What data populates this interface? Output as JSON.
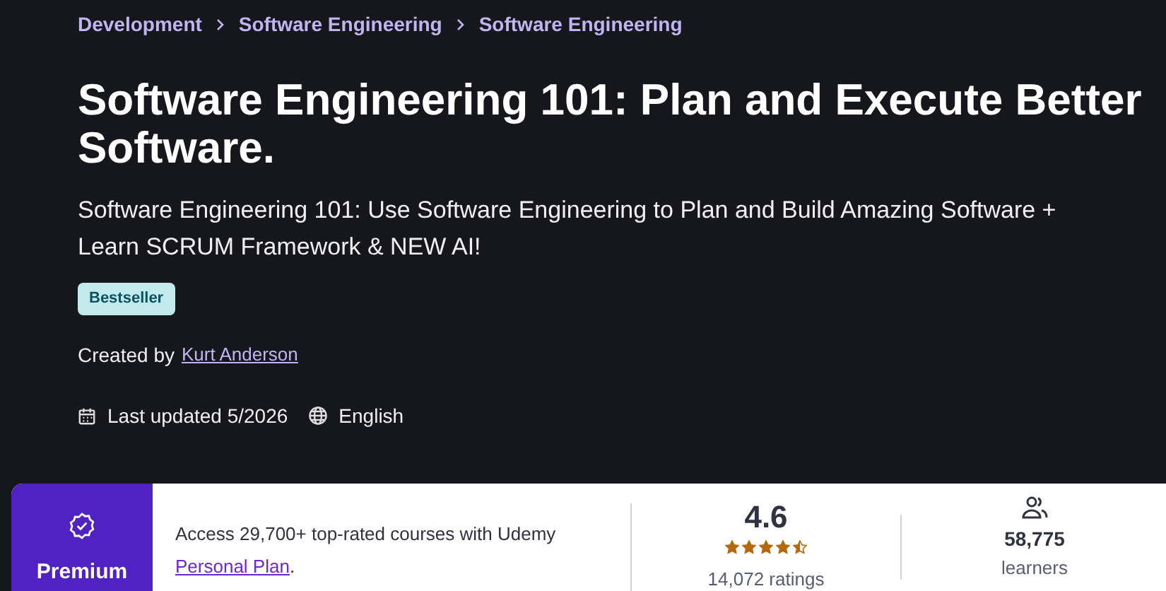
{
  "breadcrumbs": [
    "Development",
    "Software Engineering",
    "Software Engineering"
  ],
  "title": "Software Engineering 101: Plan and Execute Better Software.",
  "subtitle": "Software Engineering 101: Use Software Engineering to Plan and Build Amazing Software + Learn SCRUM Framework & NEW AI!",
  "badge": "Bestseller",
  "created_by": {
    "label": "Created by",
    "author": "Kurt Anderson"
  },
  "last_updated": "Last updated 5/2026",
  "language": "English",
  "premium_card": {
    "label": "Premium",
    "text": "Access 29,700+ top-rated courses with Udemy",
    "link": "Personal Plan",
    "link_suffix": ".",
    "rating": {
      "value": "4.6",
      "stars": 4.5,
      "count": "14,072 ratings"
    },
    "learners": {
      "value": "58,775",
      "label": "learners"
    }
  }
}
